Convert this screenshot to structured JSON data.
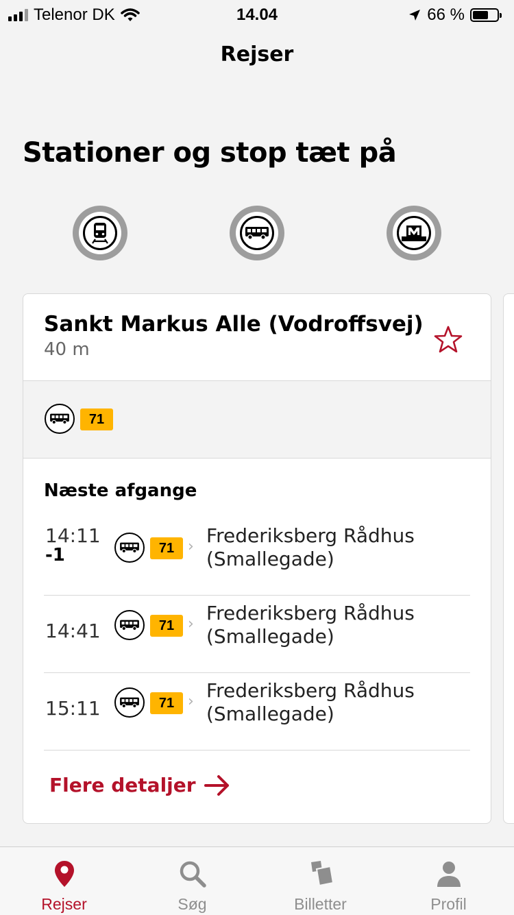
{
  "status_bar": {
    "carrier": "Telenor DK",
    "time": "14.04",
    "battery_percent": "66 %",
    "battery_level": 0.66
  },
  "nav": {
    "title": "Rejser"
  },
  "nearby": {
    "heading": "Stationer og stop tæt på",
    "filters": [
      {
        "icon": "train-icon"
      },
      {
        "icon": "bus-icon"
      },
      {
        "icon": "metro-icon"
      }
    ]
  },
  "stop_card": {
    "name": "Sankt Markus Alle (Vodroffsvej)",
    "distance": "40 m",
    "lines": [
      {
        "icon": "bus-icon",
        "number": "71"
      }
    ],
    "departures_heading": "Næste afgange",
    "departures": [
      {
        "time": "14:11",
        "delay": "-1",
        "line": "71",
        "destination_line1": "Frederiksberg Rådhus",
        "destination_line2": "(Smallegade)"
      },
      {
        "time": "14:41",
        "delay": "",
        "line": "71",
        "destination_line1": "Frederiksberg Rådhus",
        "destination_line2": "(Smallegade)"
      },
      {
        "time": "15:11",
        "delay": "",
        "line": "71",
        "destination_line1": "Frederiksberg Rådhus",
        "destination_line2": "(Smallegade)"
      }
    ],
    "details_link": "Flere detaljer"
  },
  "tabs": [
    {
      "label": "Rejser",
      "icon": "location-pin-icon",
      "active": true
    },
    {
      "label": "Søg",
      "icon": "search-icon",
      "active": false
    },
    {
      "label": "Billetter",
      "icon": "tickets-icon",
      "active": false
    },
    {
      "label": "Profil",
      "icon": "person-icon",
      "active": false
    }
  ],
  "colors": {
    "accent": "#b4122a",
    "line_badge": "#ffb400",
    "background": "#f3f3f3"
  }
}
